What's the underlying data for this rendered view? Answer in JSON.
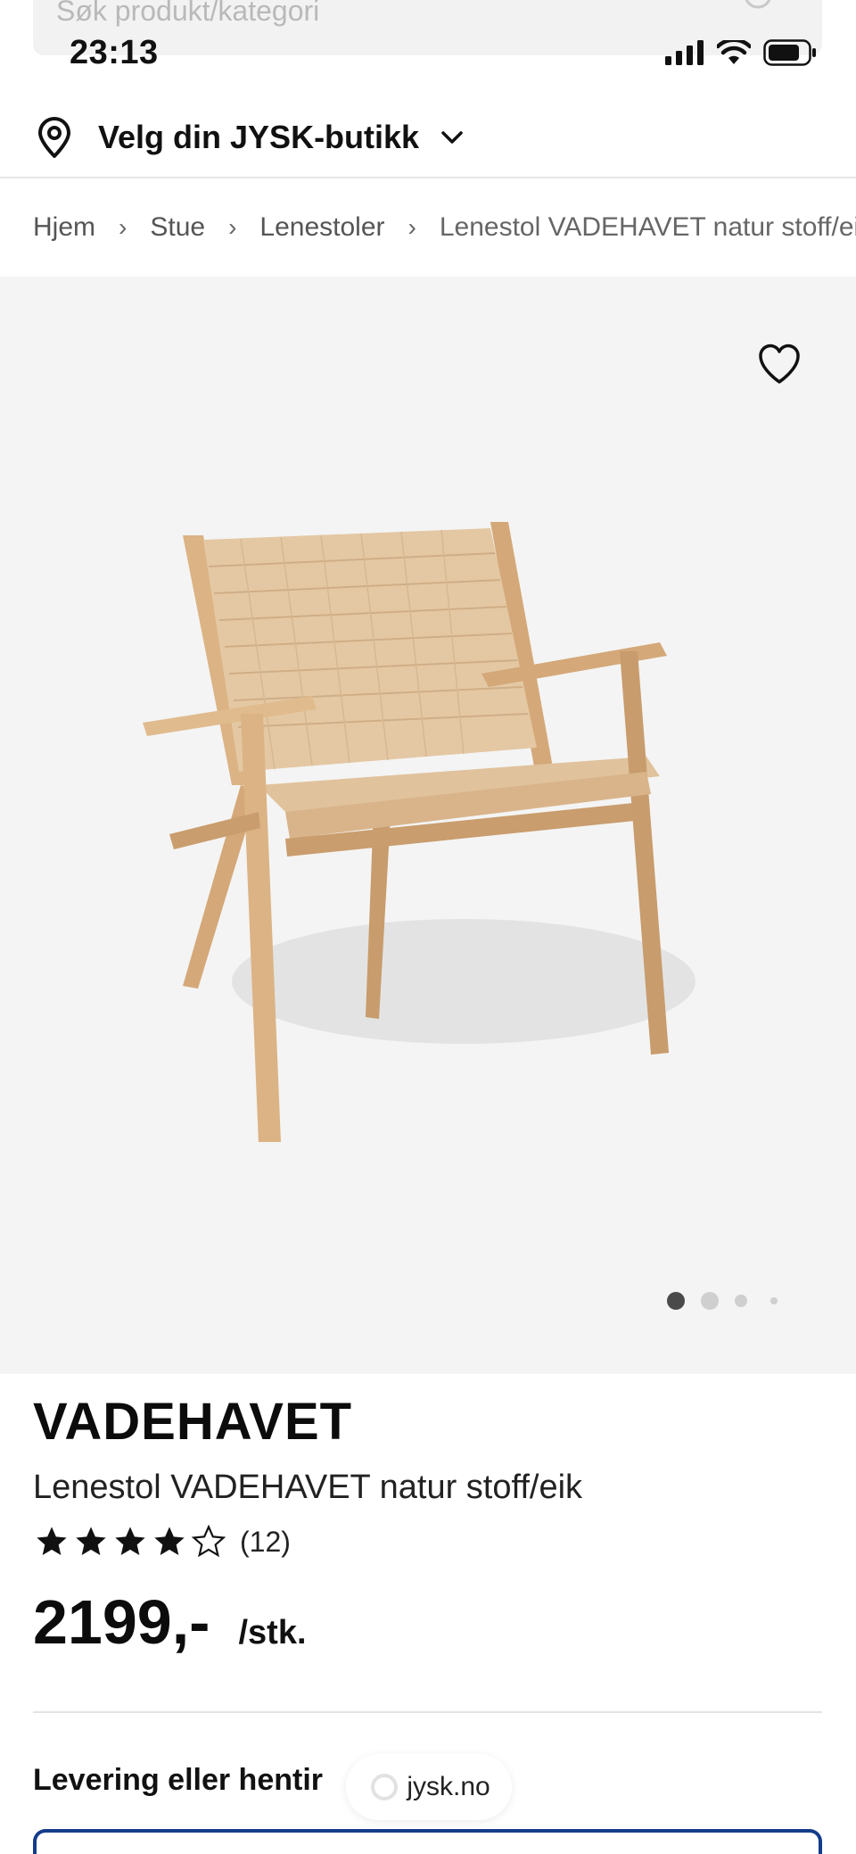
{
  "search": {
    "placeholder": "Søk produkt/kategori"
  },
  "status_bar": {
    "time": "23:13"
  },
  "store_picker": {
    "label": "Velg din JYSK-butikk"
  },
  "breadcrumb": {
    "items": [
      "Hjem",
      "Stue",
      "Lenestoler",
      "Lenestol VADEHAVET natur stoff/eik"
    ]
  },
  "gallery": {
    "slide_count": 4,
    "active_index": 0
  },
  "product": {
    "brand": "VADEHAVET",
    "name": "Lenestol VADEHAVET natur stoff/eik",
    "rating_value": 4,
    "rating_max": 5,
    "review_count": "(12)",
    "price": "2199,-",
    "unit": "/stk."
  },
  "delivery": {
    "heading": "Levering eller hentir"
  },
  "site_pill": {
    "domain": "jysk.no"
  },
  "colors": {
    "accent": "#143c8a",
    "hero_bg": "#f4f4f4",
    "wood": "#d9b48a",
    "webbing": "#e4c8a4"
  }
}
